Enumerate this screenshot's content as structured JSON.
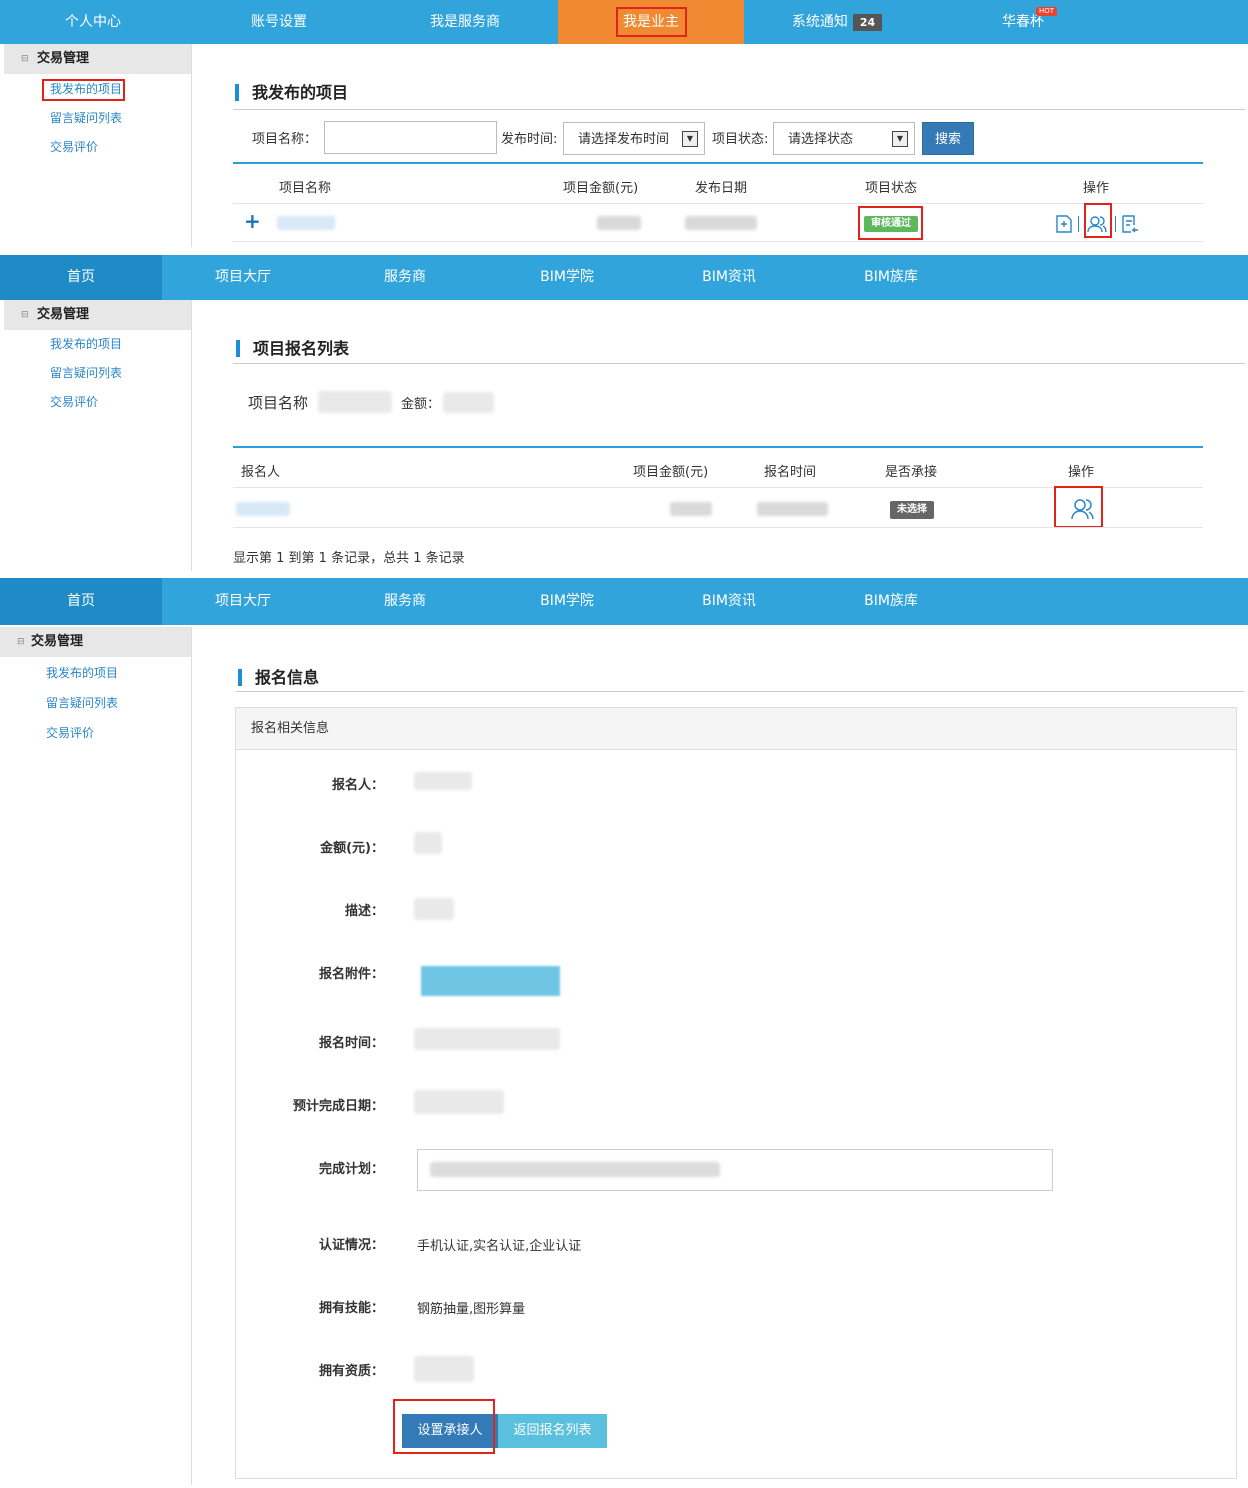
{
  "panel1": {
    "nav": [
      "个人中心",
      "账号设置",
      "我是服务商",
      "我是业主",
      "系统通知",
      "华春杯"
    ],
    "notice_count": "24",
    "hot": "HOT",
    "sidebar": {
      "header": "交易管理",
      "items": [
        "我发布的项目",
        "留言疑问列表",
        "交易评价"
      ]
    },
    "title": "我发布的项目",
    "filter": {
      "name_label": "项目名称：",
      "time_label": "发布时间:",
      "time_placeholder": "请选择发布时间",
      "status_label": "项目状态:",
      "status_placeholder": "请选择状态",
      "search": "搜索"
    },
    "table": {
      "headers": [
        "项目名称",
        "项目金额(元)",
        "发布日期",
        "项目状态",
        "操作"
      ],
      "row": {
        "expand": "+",
        "status": "审核通过"
      }
    }
  },
  "panel2": {
    "nav": [
      "首页",
      "项目大厅",
      "服务商",
      "BIM学院",
      "BIM资讯",
      "BIM族库"
    ],
    "sidebar": {
      "header": "交易管理",
      "items": [
        "我发布的项目",
        "留言疑问列表",
        "交易评价"
      ]
    },
    "title": "项目报名列表",
    "project_label": "项目名称",
    "amount_label": "金额：",
    "table": {
      "headers": [
        "报名人",
        "项目金额(元)",
        "报名时间",
        "是否承接",
        "操作"
      ],
      "row": {
        "status": "未选择"
      }
    },
    "pagination": "显示第 1 到第 1 条记录，总共 1 条记录"
  },
  "panel3": {
    "nav": [
      "首页",
      "项目大厅",
      "服务商",
      "BIM学院",
      "BIM资讯",
      "BIM族库"
    ],
    "sidebar": {
      "header": "交易管理",
      "items": [
        "我发布的项目",
        "留言疑问列表",
        "交易评价"
      ]
    },
    "title": "报名信息",
    "box_header": "报名相关信息",
    "fields": {
      "applicant": "报名人：",
      "amount": "金额(元)：",
      "desc": "描述：",
      "attachment": "报名附件：",
      "time": "报名时间：",
      "due": "预计完成日期：",
      "plan": "完成计划：",
      "cert": "认证情况：",
      "cert_value": "手机认证,实名认证,企业认证",
      "skills": "拥有技能：",
      "skills_value": "钢筋抽量,图形算量",
      "qual": "拥有资质："
    },
    "buttons": {
      "set": "设置承接人",
      "back": "返回报名列表"
    }
  },
  "colors": {
    "nav": "#31a4dc",
    "owner_tab": "#ef8a33",
    "home_tab": "#1e8bc6",
    "highlight": "#e2231a",
    "approved": "#5cb85c",
    "unselected": "#666666",
    "primary_btn": "#337ab7",
    "info_btn": "#5bc0de"
  }
}
